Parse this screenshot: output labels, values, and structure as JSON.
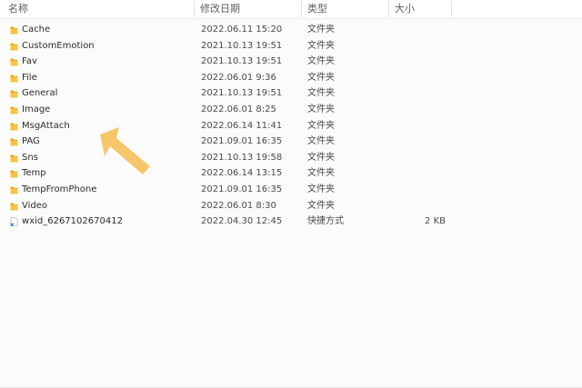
{
  "header": {
    "name": "名称",
    "modified": "修改日期",
    "type": "类型",
    "size": "大小"
  },
  "files": [
    {
      "name": "Cache",
      "modified": "2022.06.11 15:20",
      "type": "文件夹",
      "size": "",
      "icon": "folder-icon"
    },
    {
      "name": "CustomEmotion",
      "modified": "2021.10.13 19:51",
      "type": "文件夹",
      "size": "",
      "icon": "folder-icon"
    },
    {
      "name": "Fav",
      "modified": "2021.10.13 19:51",
      "type": "文件夹",
      "size": "",
      "icon": "folder-icon"
    },
    {
      "name": "File",
      "modified": "2022.06.01 9:36",
      "type": "文件夹",
      "size": "",
      "icon": "folder-icon"
    },
    {
      "name": "General",
      "modified": "2021.10.13 19:51",
      "type": "文件夹",
      "size": "",
      "icon": "folder-icon"
    },
    {
      "name": "Image",
      "modified": "2022.06.01 8:25",
      "type": "文件夹",
      "size": "",
      "icon": "folder-icon"
    },
    {
      "name": "MsgAttach",
      "modified": "2022.06.14 11:41",
      "type": "文件夹",
      "size": "",
      "icon": "folder-icon"
    },
    {
      "name": "PAG",
      "modified": "2021.09.01 16:35",
      "type": "文件夹",
      "size": "",
      "icon": "folder-icon"
    },
    {
      "name": "Sns",
      "modified": "2021.10.13 19:58",
      "type": "文件夹",
      "size": "",
      "icon": "folder-icon"
    },
    {
      "name": "Temp",
      "modified": "2022.06.14 13:15",
      "type": "文件夹",
      "size": "",
      "icon": "folder-icon"
    },
    {
      "name": "TempFromPhone",
      "modified": "2021.09.01 16:35",
      "type": "文件夹",
      "size": "",
      "icon": "folder-icon"
    },
    {
      "name": "Video",
      "modified": "2022.06.01 8:30",
      "type": "文件夹",
      "size": "",
      "icon": "folder-icon"
    },
    {
      "name": "wxid_6267102670412",
      "modified": "2022.04.30 12:45",
      "type": "快捷方式",
      "size": "2 KB",
      "icon": "shortcut-icon"
    }
  ],
  "annotation": {
    "arrow_color": "#f7c56a",
    "arrow_icon": "pointer-arrow-icon"
  },
  "colors": {
    "folder": "#f5c542",
    "folder_dark": "#e2a91f",
    "shortcut_blue": "#2b7bd8"
  }
}
